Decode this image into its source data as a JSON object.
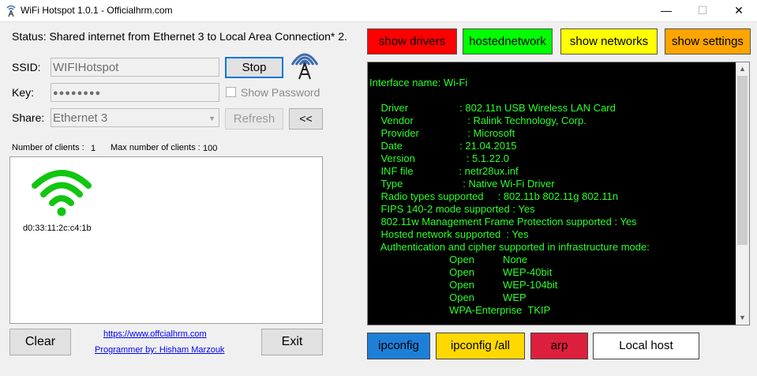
{
  "window": {
    "title": "WiFi Hotspot 1.0.1 - Officialhrm.com",
    "controls": {
      "minimize": "—",
      "maximize": "☐",
      "close": "✕"
    }
  },
  "status": "Status: Shared internet from Ethernet 3 to Local Area Connection* 2.",
  "form": {
    "ssid_label": "SSID:",
    "ssid_value": "WIFIHotspot",
    "key_label": "Key:",
    "key_value": "●●●●●●●●",
    "share_label": "Share:",
    "share_value": "Ethernet 3",
    "stop_label": "Stop",
    "show_password_label": "Show Password",
    "refresh_label": "Refresh",
    "collapse_label": "<<"
  },
  "clients": {
    "count_label": "Number of clients :",
    "count_value": "1",
    "max_label": "Max number of clients :",
    "max_value": "100",
    "list": [
      {
        "mac": "d0:33:11:2c:c4:1b"
      }
    ]
  },
  "footer": {
    "clear_label": "Clear",
    "exit_label": "Exit",
    "website_link": "https://www.offcialhrm.com",
    "programmer_link": "Programmer by: Hisham Marzouk"
  },
  "top_buttons": [
    {
      "label": "show drivers",
      "color": "#ff0000"
    },
    {
      "label": "hostednetwork",
      "color": "#00ff00"
    },
    {
      "label": "show networks",
      "color": "#ffff00"
    },
    {
      "label": "show settings",
      "color": "#ffa500"
    }
  ],
  "bottom_buttons": [
    {
      "label": "ipconfig",
      "color": "#1e7fd8"
    },
    {
      "label": "ipconfig /all",
      "color": "#ffd800"
    },
    {
      "label": "arp",
      "color": "#dc1f3c"
    },
    {
      "label": "Local host",
      "color": "#ffffff"
    }
  ],
  "console": {
    "text_color": "#2aff2a",
    "lines": [
      "Interface name: Wi-Fi",
      "",
      "    Driver                  : 802.11n USB Wireless LAN Card",
      "    Vendor                   : Ralink Technology, Corp.",
      "    Provider                 : Microsoft",
      "    Date                    : 21.04.2015",
      "    Version                  : 5.1.22.0",
      "    INF file                : netr28ux.inf",
      "    Type                     : Native Wi-Fi Driver",
      "    Radio types supported     : 802.11b 802.11g 802.11n",
      "    FIPS 140-2 mode supported : Yes",
      "    802.11w Management Frame Protection supported : Yes",
      "    Hosted network supported  : Yes",
      "    Authentication and cipher supported in infrastructure mode:",
      "                            Open          None",
      "                            Open          WEP-40bit",
      "                            Open          WEP-104bit",
      "                            Open          WEP",
      "                            WPA-Enterprise  TKIP"
    ]
  }
}
